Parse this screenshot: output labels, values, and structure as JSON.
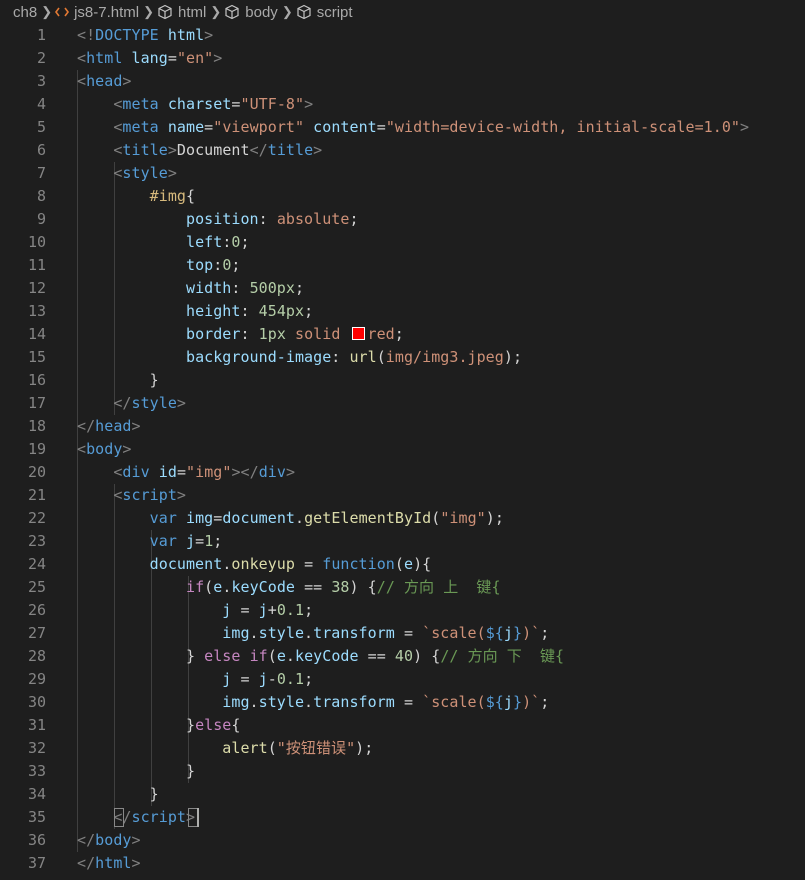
{
  "breadcrumb": {
    "folder": "ch8",
    "file": "js8-7.html",
    "items": [
      "html",
      "body",
      "script"
    ]
  },
  "line_numbers": [
    "1",
    "2",
    "3",
    "4",
    "5",
    "6",
    "7",
    "8",
    "9",
    "10",
    "11",
    "12",
    "13",
    "14",
    "15",
    "16",
    "17",
    "18",
    "19",
    "20",
    "21",
    "22",
    "23",
    "24",
    "25",
    "26",
    "27",
    "28",
    "29",
    "30",
    "31",
    "32",
    "33",
    "34",
    "35",
    "36",
    "37"
  ],
  "code_lines": [
    [
      [
        "t-brk",
        "<!"
      ],
      [
        "t-tag",
        "DOCTYPE"
      ],
      [
        "t-txt",
        " "
      ],
      [
        "t-attr",
        "html"
      ],
      [
        "t-brk",
        ">"
      ]
    ],
    [
      [
        "t-brk",
        "<"
      ],
      [
        "t-tag",
        "html"
      ],
      [
        "t-txt",
        " "
      ],
      [
        "t-attr",
        "lang"
      ],
      [
        "t-txt",
        "="
      ],
      [
        "t-str",
        "\"en\""
      ],
      [
        "t-brk",
        ">"
      ]
    ],
    [
      [
        "t-brk",
        "<"
      ],
      [
        "t-tag",
        "head"
      ],
      [
        "t-brk",
        ">"
      ]
    ],
    [
      [
        "t-txt",
        "    "
      ],
      [
        "t-brk",
        "<"
      ],
      [
        "t-tag",
        "meta"
      ],
      [
        "t-txt",
        " "
      ],
      [
        "t-attr",
        "charset"
      ],
      [
        "t-txt",
        "="
      ],
      [
        "t-str",
        "\"UTF-8\""
      ],
      [
        "t-brk",
        ">"
      ]
    ],
    [
      [
        "t-txt",
        "    "
      ],
      [
        "t-brk",
        "<"
      ],
      [
        "t-tag",
        "meta"
      ],
      [
        "t-txt",
        " "
      ],
      [
        "t-attr",
        "name"
      ],
      [
        "t-txt",
        "="
      ],
      [
        "t-str",
        "\"viewport\""
      ],
      [
        "t-txt",
        " "
      ],
      [
        "t-attr",
        "content"
      ],
      [
        "t-txt",
        "="
      ],
      [
        "t-str",
        "\"width=device-width, initial-scale=1.0\""
      ],
      [
        "t-brk",
        ">"
      ]
    ],
    [
      [
        "t-txt",
        "    "
      ],
      [
        "t-brk",
        "<"
      ],
      [
        "t-tag",
        "title"
      ],
      [
        "t-brk",
        ">"
      ],
      [
        "t-txt",
        "Document"
      ],
      [
        "t-brk",
        "</"
      ],
      [
        "t-tag",
        "title"
      ],
      [
        "t-brk",
        ">"
      ]
    ],
    [
      [
        "t-txt",
        "    "
      ],
      [
        "t-brk",
        "<"
      ],
      [
        "t-tag",
        "style"
      ],
      [
        "t-brk",
        ">"
      ]
    ],
    [
      [
        "t-txt",
        "        "
      ],
      [
        "t-sel",
        "#img"
      ],
      [
        "t-txt",
        "{"
      ]
    ],
    [
      [
        "t-txt",
        "            "
      ],
      [
        "t-prop",
        "position"
      ],
      [
        "t-txt",
        ": "
      ],
      [
        "t-str",
        "absolute"
      ],
      [
        "t-txt",
        ";"
      ]
    ],
    [
      [
        "t-txt",
        "            "
      ],
      [
        "t-prop",
        "left"
      ],
      [
        "t-txt",
        ":"
      ],
      [
        "t-num",
        "0"
      ],
      [
        "t-txt",
        ";"
      ]
    ],
    [
      [
        "t-txt",
        "            "
      ],
      [
        "t-prop",
        "top"
      ],
      [
        "t-txt",
        ":"
      ],
      [
        "t-num",
        "0"
      ],
      [
        "t-txt",
        ";"
      ]
    ],
    [
      [
        "t-txt",
        "            "
      ],
      [
        "t-prop",
        "width"
      ],
      [
        "t-txt",
        ": "
      ],
      [
        "t-num",
        "500px"
      ],
      [
        "t-txt",
        ";"
      ]
    ],
    [
      [
        "t-txt",
        "            "
      ],
      [
        "t-prop",
        "height"
      ],
      [
        "t-txt",
        ": "
      ],
      [
        "t-num",
        "454px"
      ],
      [
        "t-txt",
        ";"
      ]
    ],
    [
      [
        "t-txt",
        "            "
      ],
      [
        "t-prop",
        "border"
      ],
      [
        "t-txt",
        ": "
      ],
      [
        "t-num",
        "1px"
      ],
      [
        "t-txt",
        " "
      ],
      [
        "t-str",
        "solid"
      ],
      [
        "t-txt",
        " "
      ],
      [
        "swatch",
        ""
      ],
      [
        "t-str",
        "red"
      ],
      [
        "t-txt",
        ";"
      ]
    ],
    [
      [
        "t-txt",
        "            "
      ],
      [
        "t-prop",
        "background-image"
      ],
      [
        "t-txt",
        ": "
      ],
      [
        "t-fn",
        "url"
      ],
      [
        "t-txt",
        "("
      ],
      [
        "t-url",
        "img/img3.jpeg"
      ],
      [
        "t-txt",
        ");"
      ]
    ],
    [
      [
        "t-txt",
        "        }"
      ]
    ],
    [
      [
        "t-txt",
        "    "
      ],
      [
        "t-brk",
        "</"
      ],
      [
        "t-tag",
        "style"
      ],
      [
        "t-brk",
        ">"
      ]
    ],
    [
      [
        "t-brk",
        "</"
      ],
      [
        "t-tag",
        "head"
      ],
      [
        "t-brk",
        ">"
      ]
    ],
    [
      [
        "t-brk",
        "<"
      ],
      [
        "t-tag",
        "body"
      ],
      [
        "t-brk",
        ">"
      ]
    ],
    [
      [
        "t-txt",
        "    "
      ],
      [
        "t-brk",
        "<"
      ],
      [
        "t-tag",
        "div"
      ],
      [
        "t-txt",
        " "
      ],
      [
        "t-attr",
        "id"
      ],
      [
        "t-txt",
        "="
      ],
      [
        "t-str",
        "\"img\""
      ],
      [
        "t-brk",
        "></"
      ],
      [
        "t-tag",
        "div"
      ],
      [
        "t-brk",
        ">"
      ]
    ],
    [
      [
        "t-txt",
        "    "
      ],
      [
        "t-brk",
        "<"
      ],
      [
        "t-tag",
        "script"
      ],
      [
        "t-brk",
        ">"
      ]
    ],
    [
      [
        "t-txt",
        "        "
      ],
      [
        "t-kw",
        "var"
      ],
      [
        "t-txt",
        " "
      ],
      [
        "t-var",
        "img"
      ],
      [
        "t-txt",
        "="
      ],
      [
        "t-var",
        "document"
      ],
      [
        "t-txt",
        "."
      ],
      [
        "t-fn",
        "getElementById"
      ],
      [
        "t-txt",
        "("
      ],
      [
        "t-str",
        "\"img\""
      ],
      [
        "t-txt",
        ");"
      ]
    ],
    [
      [
        "t-txt",
        "        "
      ],
      [
        "t-kw",
        "var"
      ],
      [
        "t-txt",
        " "
      ],
      [
        "t-var",
        "j"
      ],
      [
        "t-txt",
        "="
      ],
      [
        "t-num",
        "1"
      ],
      [
        "t-txt",
        ";"
      ]
    ],
    [
      [
        "t-txt",
        "        "
      ],
      [
        "t-var",
        "document"
      ],
      [
        "t-txt",
        "."
      ],
      [
        "t-fn",
        "onkeyup"
      ],
      [
        "t-txt",
        " = "
      ],
      [
        "t-kw",
        "function"
      ],
      [
        "t-txt",
        "("
      ],
      [
        "t-var",
        "e"
      ],
      [
        "t-txt",
        "){"
      ]
    ],
    [
      [
        "t-txt",
        "            "
      ],
      [
        "t-ctrl",
        "if"
      ],
      [
        "t-txt",
        "("
      ],
      [
        "t-var",
        "e"
      ],
      [
        "t-txt",
        "."
      ],
      [
        "t-var",
        "keyCode"
      ],
      [
        "t-txt",
        " == "
      ],
      [
        "t-num",
        "38"
      ],
      [
        "t-txt",
        ") {"
      ],
      [
        "t-cmt",
        "// 方向 上  键{"
      ]
    ],
    [
      [
        "t-txt",
        "                "
      ],
      [
        "t-var",
        "j"
      ],
      [
        "t-txt",
        " = "
      ],
      [
        "t-var",
        "j"
      ],
      [
        "t-txt",
        "+"
      ],
      [
        "t-num",
        "0.1"
      ],
      [
        "t-txt",
        ";"
      ]
    ],
    [
      [
        "t-txt",
        "                "
      ],
      [
        "t-var",
        "img"
      ],
      [
        "t-txt",
        "."
      ],
      [
        "t-var",
        "style"
      ],
      [
        "t-txt",
        "."
      ],
      [
        "t-var",
        "transform"
      ],
      [
        "t-txt",
        " = "
      ],
      [
        "t-str",
        "`scale("
      ],
      [
        "t-kw",
        "${"
      ],
      [
        "t-var",
        "j"
      ],
      [
        "t-kw",
        "}"
      ],
      [
        "t-str",
        ")`"
      ],
      [
        "t-txt",
        ";"
      ]
    ],
    [
      [
        "t-txt",
        "            } "
      ],
      [
        "t-ctrl",
        "else"
      ],
      [
        "t-txt",
        " "
      ],
      [
        "t-ctrl",
        "if"
      ],
      [
        "t-txt",
        "("
      ],
      [
        "t-var",
        "e"
      ],
      [
        "t-txt",
        "."
      ],
      [
        "t-var",
        "keyCode"
      ],
      [
        "t-txt",
        " == "
      ],
      [
        "t-num",
        "40"
      ],
      [
        "t-txt",
        ") {"
      ],
      [
        "t-cmt",
        "// 方向 下  键{"
      ]
    ],
    [
      [
        "t-txt",
        "                "
      ],
      [
        "t-var",
        "j"
      ],
      [
        "t-txt",
        " = "
      ],
      [
        "t-var",
        "j"
      ],
      [
        "t-txt",
        "-"
      ],
      [
        "t-num",
        "0.1"
      ],
      [
        "t-txt",
        ";"
      ]
    ],
    [
      [
        "t-txt",
        "                "
      ],
      [
        "t-var",
        "img"
      ],
      [
        "t-txt",
        "."
      ],
      [
        "t-var",
        "style"
      ],
      [
        "t-txt",
        "."
      ],
      [
        "t-var",
        "transform"
      ],
      [
        "t-txt",
        " = "
      ],
      [
        "t-str",
        "`scale("
      ],
      [
        "t-kw",
        "${"
      ],
      [
        "t-var",
        "j"
      ],
      [
        "t-kw",
        "}"
      ],
      [
        "t-str",
        ")`"
      ],
      [
        "t-txt",
        ";"
      ]
    ],
    [
      [
        "t-txt",
        "            }"
      ],
      [
        "t-ctrl",
        "else"
      ],
      [
        "t-txt",
        "{"
      ]
    ],
    [
      [
        "t-txt",
        "                "
      ],
      [
        "t-fn",
        "alert"
      ],
      [
        "t-txt",
        "("
      ],
      [
        "t-str",
        "\"按钮错误\""
      ],
      [
        "t-txt",
        ");"
      ]
    ],
    [
      [
        "t-txt",
        "            }"
      ]
    ],
    [
      [
        "t-txt",
        "        }"
      ]
    ],
    [
      [
        "t-txt",
        "    "
      ],
      [
        "t-brk",
        "</"
      ],
      [
        "t-tag",
        "script"
      ],
      [
        "t-brk",
        ">"
      ]
    ],
    [
      [
        "t-brk",
        "</"
      ],
      [
        "t-tag",
        "body"
      ],
      [
        "t-brk",
        ">"
      ]
    ],
    [
      [
        "t-brk",
        "</"
      ],
      [
        "t-tag",
        "html"
      ],
      [
        "t-brk",
        ">"
      ]
    ]
  ],
  "colors": {
    "background": "#1e1e1e",
    "line_number": "#858585",
    "tag": "#569cd6",
    "attribute": "#9cdcfe",
    "string": "#ce9178",
    "comment": "#6a9955",
    "function": "#dcdcaa",
    "number": "#b5cea8",
    "control": "#c586c0",
    "selector": "#d7ba7d",
    "color_swatch": "#ff0000"
  },
  "icons": {
    "file": "html-file-icon",
    "element": "cube-icon"
  }
}
